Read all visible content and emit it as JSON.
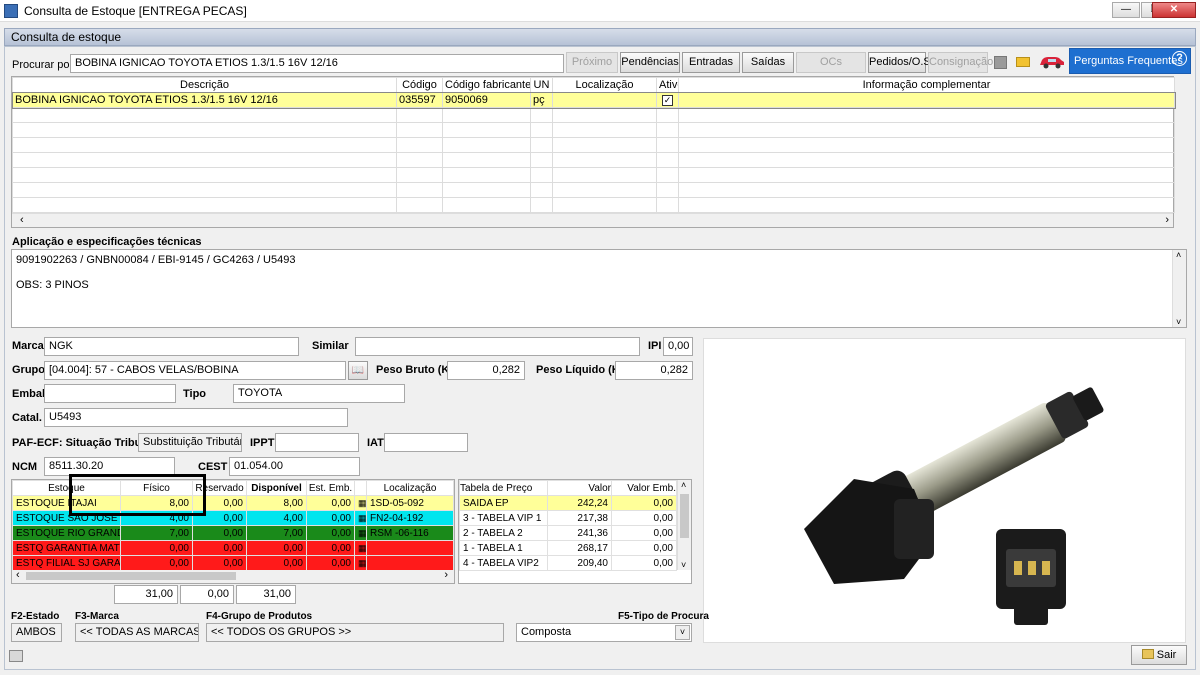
{
  "window": {
    "title": "Consulta de Estoque [ENTREGA PECAS]"
  },
  "panel": {
    "title": "Consulta de estoque"
  },
  "search": {
    "label": "Procurar por",
    "value": "BOBINA IGNICAO TOYOTA ETIOS 1.3/1.5 16V 12/16",
    "buttons": {
      "proximo": "Próximo",
      "pendencias": "Pendências",
      "entradas": "Entradas",
      "saidas": "Saídas",
      "ocs": "OCs",
      "pedidos": "Pedidos/O.S.",
      "consignacao": "Consignação"
    },
    "help": "Perguntas Frequentes"
  },
  "products": {
    "headers": [
      "Descrição",
      "Código",
      "Código fabricante",
      "UN",
      "Localização",
      "Ativo",
      "Informação complementar"
    ],
    "row": {
      "descricao": "BOBINA IGNICAO TOYOTA ETIOS 1.3/1.5 16V 12/16",
      "codigo": "035597",
      "fabricante": "9050069",
      "un": "pç",
      "localizacao": "",
      "info": ""
    }
  },
  "aplicacao": {
    "label": "Aplicação e especificações técnicas",
    "line1": "9091902263 / GNBN00084 / EBI-9145 / GC4263 / U5493",
    "line2": "OBS: 3 PINOS"
  },
  "fields": {
    "marca_label": "Marca",
    "marca": "NGK",
    "similar_label": "Similar",
    "similar": "",
    "ipi_label": "IPI",
    "ipi": "0,00",
    "grupo_label": "Grupo",
    "grupo": "[04.004]: 57 - CABOS VELAS/BOBINA",
    "peso_bruto_label": "Peso Bruto (Kg)",
    "peso_bruto": "0,282",
    "peso_liquido_label": "Peso Líquido (Kg)",
    "peso_liquido": "0,282",
    "embal_label": "Embal.",
    "embal": "",
    "tipo_label": "Tipo",
    "tipo": "TOYOTA",
    "catal_label": "Catal.",
    "catal": "U5493",
    "paf_label": "PAF-ECF: Situação Tributária",
    "paf": "Substituição Tributária",
    "ippt_label": "IPPT",
    "ippt": "",
    "iat_label": "IAT",
    "iat": "",
    "ncm_label": "NCM",
    "ncm": "8511.30.20",
    "cest_label": "CEST",
    "cest": "01.054.00"
  },
  "estoque": {
    "headers": [
      "Estoque",
      "Físico",
      "Reservado",
      "Disponível",
      "Est. Emb.",
      "",
      "Localização"
    ],
    "rows": [
      {
        "nome": "ESTOQUE ITAJAI",
        "fisico": "8,00",
        "reservado": "0,00",
        "disponivel": "8,00",
        "emb": "0,00",
        "loc": "1SD-05-092",
        "color": "#ffff99"
      },
      {
        "nome": "ESTOQUE SAO JOSE",
        "fisico": "4,00",
        "reservado": "0,00",
        "disponivel": "4,00",
        "emb": "0,00",
        "loc": "FN2-04-192",
        "color": "#00e5ee"
      },
      {
        "nome": "ESTOQUE RIO GRANDE",
        "fisico": "7,00",
        "reservado": "0,00",
        "disponivel": "7,00",
        "emb": "0,00",
        "loc": "RSM -06-116",
        "color": "#1a8a1a"
      },
      {
        "nome": "ESTQ GARANTIA MATRI",
        "fisico": "0,00",
        "reservado": "0,00",
        "disponivel": "0,00",
        "emb": "0,00",
        "loc": "",
        "color": "#ff1a1a"
      },
      {
        "nome": "ESTQ FILIAL SJ GARAN",
        "fisico": "0,00",
        "reservado": "0,00",
        "disponivel": "0,00",
        "emb": "0,00",
        "loc": "",
        "color": "#ff1a1a"
      }
    ],
    "totals": {
      "fisico": "31,00",
      "reservado": "0,00",
      "disponivel": "31,00"
    }
  },
  "precos": {
    "headers": [
      "Tabela de Preço",
      "Valor",
      "Valor Emb."
    ],
    "rows": [
      {
        "tabela": "SAIDA EP",
        "valor": "242,24",
        "emb": "0,00"
      },
      {
        "tabela": "3 - TABELA VIP 1",
        "valor": "217,38",
        "emb": "0,00"
      },
      {
        "tabela": "2 - TABELA 2",
        "valor": "241,36",
        "emb": "0,00"
      },
      {
        "tabela": "1 - TABELA 1",
        "valor": "268,17",
        "emb": "0,00"
      },
      {
        "tabela": "4 - TABELA VIP2",
        "valor": "209,40",
        "emb": "0,00"
      }
    ]
  },
  "footer": {
    "f2_label": "F2-Estado",
    "f2": "AMBOS",
    "f3_label": "F3-Marca",
    "f3": "<< TODAS AS MARCAS >>",
    "f4_label": "F4-Grupo de Produtos",
    "f4": "<< TODOS OS GRUPOS >>",
    "f5_label": "F5-Tipo de Procura",
    "f5": "Composta",
    "sair": "Sair"
  }
}
